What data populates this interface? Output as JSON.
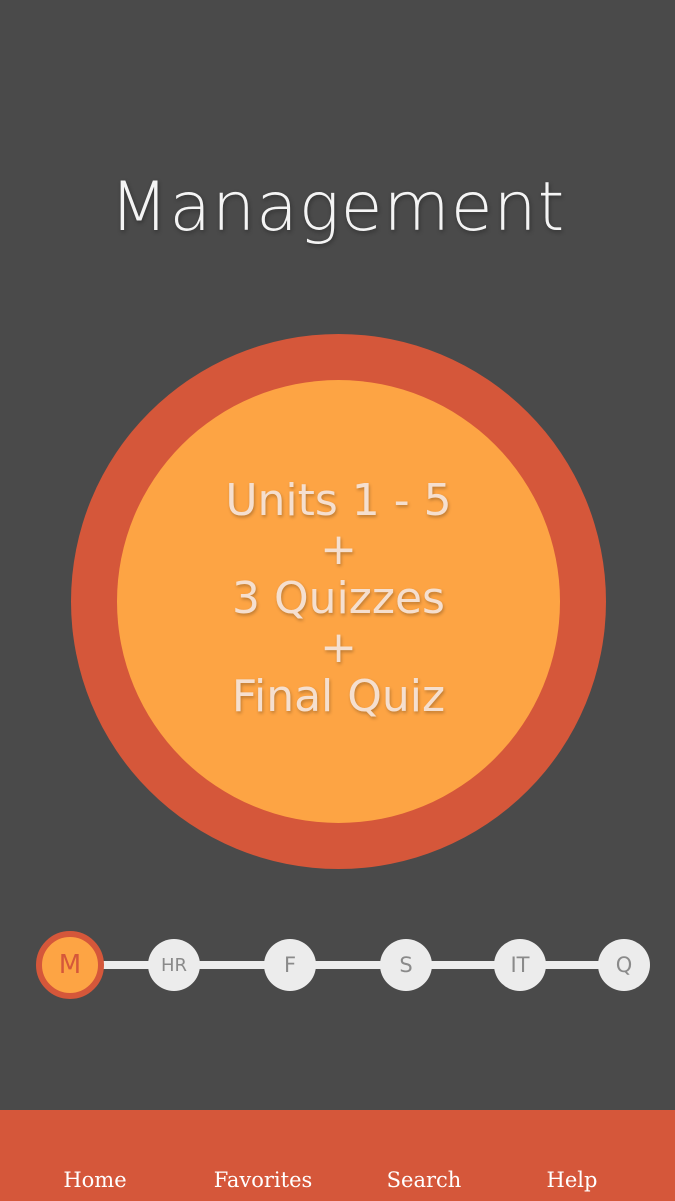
{
  "page": {
    "title": "Management"
  },
  "course_card": {
    "lines": [
      "Units 1 - 5",
      "+",
      "3 Quizzes",
      "+",
      "Final Quiz"
    ]
  },
  "progress_steps": [
    {
      "label": "M",
      "active": true
    },
    {
      "label": "HR",
      "active": false
    },
    {
      "label": "F",
      "active": false
    },
    {
      "label": "S",
      "active": false
    },
    {
      "label": "IT",
      "active": false
    },
    {
      "label": "Q",
      "active": false
    }
  ],
  "bottom_nav": {
    "items": [
      {
        "label": "Home"
      },
      {
        "label": "Favorites"
      },
      {
        "label": "Search"
      },
      {
        "label": "Help"
      }
    ]
  },
  "colors": {
    "background": "#4a4a4a",
    "accent_red": "#d5573a",
    "accent_orange": "#fda444",
    "step_inactive": "#ececec"
  }
}
